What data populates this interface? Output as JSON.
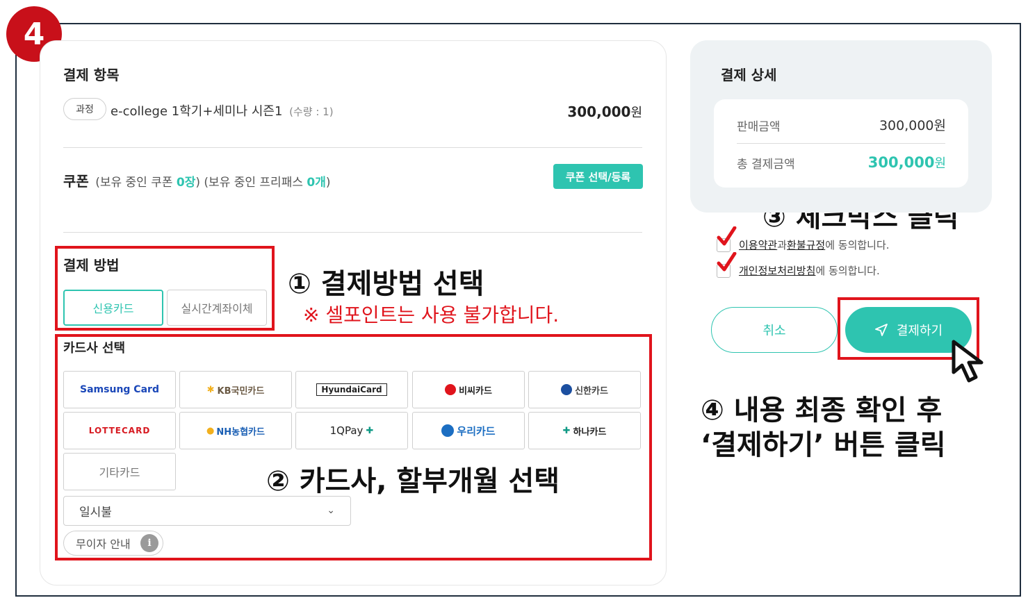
{
  "step_badge": "4",
  "payment_items": {
    "title": "결제 항목",
    "tag": "과정",
    "course_name": "e-college 1학기+세미나 시즌1",
    "quantity": "(수량 : 1)",
    "price_amount": "300,000",
    "price_unit": "원"
  },
  "coupon": {
    "title": "쿠폰",
    "held_coupon_prefix": "(보유 중인 쿠폰 ",
    "held_coupon_count": "0장",
    "held_coupon_suffix": ")",
    "held_pass_prefix": "(보유 중인 프리패스 ",
    "held_pass_count": "0개",
    "held_pass_suffix": ")",
    "button": "쿠폰 선택/등록"
  },
  "payment_method": {
    "title": "결제 방법",
    "credit_card": "신용카드",
    "realtime_transfer": "실시간계좌이체"
  },
  "card_select": {
    "title": "카드사 선택",
    "cards": [
      {
        "label": "Samsung Card",
        "color": "#1a47b8"
      },
      {
        "label": "KB국민카드",
        "color": "#6b5a44"
      },
      {
        "label": "HyundaiCard",
        "color": "#222222"
      },
      {
        "label": "비씨카드",
        "color": "#222222"
      },
      {
        "label": "신한카드",
        "color": "#444444"
      },
      {
        "label": "LOTTECARD",
        "color": "#d71a21"
      },
      {
        "label": "NH농협카드",
        "color": "#1a5fb4"
      },
      {
        "label": "1QPay",
        "color": "#222222"
      },
      {
        "label": "우리카드",
        "color": "#1c6ec2"
      },
      {
        "label": "하나카드",
        "color": "#222222"
      },
      {
        "label": "기타카드",
        "color": "#777777"
      }
    ],
    "installment_selected": "일시불",
    "interest_free_button": "무이자 안내"
  },
  "payment_detail": {
    "title": "결제 상세",
    "sale_label": "판매금액",
    "sale_amount": "300,000원",
    "total_label": "총 결제금액",
    "total_amount": "300,000",
    "total_unit": "원"
  },
  "agreements": {
    "terms_link": "이용약관",
    "terms_mid": "과 ",
    "refund_link": "환불규정",
    "terms_suffix": "에 동의합니다.",
    "privacy_link": "개인정보처리방침",
    "privacy_suffix": "에 동의합니다."
  },
  "buttons": {
    "cancel": "취소",
    "pay": "결제하기"
  },
  "annotations": {
    "step1": "① 결제방법 선택",
    "step1_note": "※ 셀포인트는 사용 불가합니다.",
    "step2": "② 카드사, 할부개월 선택",
    "step3": "③ 체크박스 클릭",
    "step4_line1": "④ 내용 최종 확인 후",
    "step4_line2": "‘결제하기’ 버튼 클릭"
  },
  "colors": {
    "accent": "#2ec4b0",
    "annotation_red": "#e0141c",
    "badge_red": "#c8101a"
  }
}
